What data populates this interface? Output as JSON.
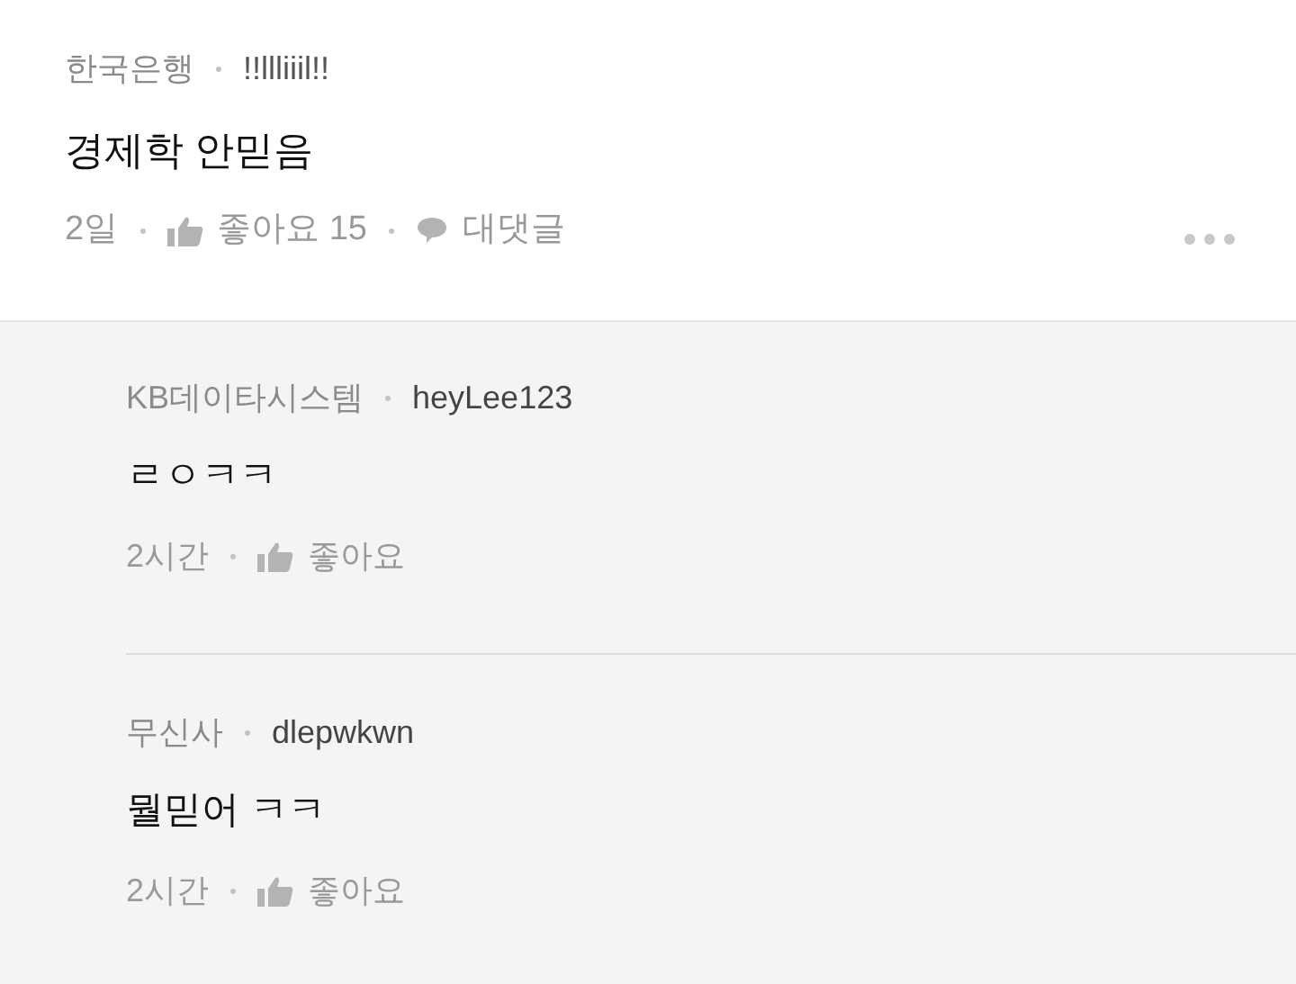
{
  "post": {
    "company": "한국은행",
    "user": "!!llliiil!!",
    "body": "경제학 안믿음",
    "time": "2일",
    "like_label": "좋아요",
    "like_count": "15",
    "reply_label": "대댓글"
  },
  "replies": [
    {
      "company": "KB데이타시스템",
      "user": "heyLee123",
      "body": "ㄹㅇㅋㅋ",
      "time": "2시간",
      "like_label": "좋아요"
    },
    {
      "company": "무신사",
      "user": "dlepwkwn",
      "body": "뭘믿어 ㅋㅋ",
      "time": "2시간",
      "like_label": "좋아요"
    }
  ]
}
